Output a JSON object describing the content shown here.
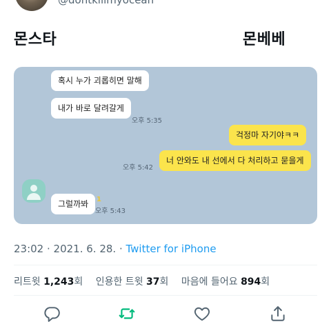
{
  "header": {
    "handle": "@dontkillmyocean"
  },
  "labels": {
    "left": "몬스타",
    "right": "몬베베"
  },
  "chat": {
    "messages": [
      {
        "text": "혹시 누가 괴롭히면 말해",
        "side": "left"
      },
      {
        "text": "내가 바로 달려갈게",
        "side": "left",
        "time": "오후 5:35"
      },
      {
        "text": "걱정마 자기야ㅋㅋ",
        "side": "right"
      },
      {
        "text": "너 안와도 내 선에서 다 처리하고 묻을게",
        "side": "right",
        "time": "오후 5:42"
      },
      {
        "text": "그럴까봐",
        "side": "left",
        "time": "오후 5:43",
        "unread": "1"
      }
    ]
  },
  "meta": {
    "datetime": "23:02 · 2021. 6. 28. · ",
    "source": "Twitter for iPhone"
  },
  "stats": {
    "retweets_label": "리트윗",
    "retweets_count": "1,243",
    "retweets_unit": "회",
    "quotes_label": "인용한 트윗",
    "quotes_count": "37",
    "quotes_unit": "회",
    "likes_label": "마음에 들어요",
    "likes_count": "894",
    "likes_unit": "회"
  },
  "icons": {
    "reply": "reply-icon",
    "retweet": "retweet-icon",
    "like": "like-icon",
    "share": "share-icon"
  },
  "colors": {
    "chat_background": "#b2c6d8",
    "my_bubble": "#fbe44c",
    "link": "#1d9bf0",
    "retweet_green": "#00ba7c"
  }
}
